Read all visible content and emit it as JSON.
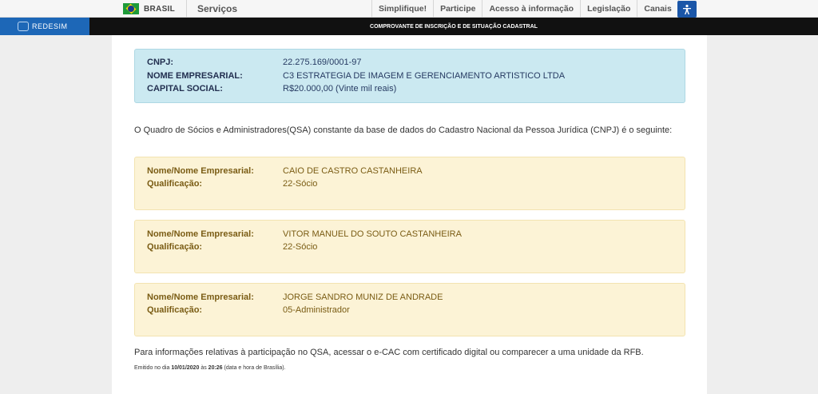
{
  "govbar": {
    "country": "BRASIL",
    "services": "Serviços",
    "links": [
      "Simplifique!",
      "Participe",
      "Acesso à informação",
      "Legislação",
      "Canais"
    ]
  },
  "topbar": {
    "brand": "REDESIM",
    "title": "COMPROVANTE DE INSCRIÇÃO E DE SITUAÇÃO CADASTRAL"
  },
  "company": {
    "cnpj_label": "CNPJ:",
    "cnpj": "22.275.169/0001-97",
    "name_label": "NOME EMPRESARIAL:",
    "name": "C3 ESTRATEGIA DE IMAGEM E GERENCIAMENTO ARTISTICO LTDA",
    "capital_label": "CAPITAL SOCIAL:",
    "capital": "R$20.000,00 (Vinte mil reais)"
  },
  "intro": "O Quadro de Sócios e Administradores(QSA) constante da base de dados do Cadastro Nacional da Pessoa Jurídica (CNPJ) é o seguinte:",
  "partners": [
    {
      "name_label": "Nome/Nome Empresarial:",
      "name": "CAIO DE CASTRO CASTANHEIRA",
      "role_label": "Qualificação:",
      "role": "22-Sócio"
    },
    {
      "name_label": "Nome/Nome Empresarial:",
      "name": "VITOR MANUEL DO SOUTO CASTANHEIRA",
      "role_label": "Qualificação:",
      "role": "22-Sócio"
    },
    {
      "name_label": "Nome/Nome Empresarial:",
      "name": "JORGE SANDRO MUNIZ DE ANDRADE",
      "role_label": "Qualificação:",
      "role": "05-Administrador"
    }
  ],
  "footnote": "Para informações relativas à participação no QSA, acessar o e-CAC com certificado digital ou comparecer a uma unidade da RFB.",
  "emitted": {
    "prefix": "Emitido no dia",
    "date": "10/01/2020",
    "middle": "às",
    "time": "20:26",
    "suffix": "(data e hora de Brasília)."
  },
  "colors": {
    "info_bg": "#cbe9f1",
    "partner_bg": "#fcf3d6",
    "brand_blue": "#1d67b7"
  }
}
